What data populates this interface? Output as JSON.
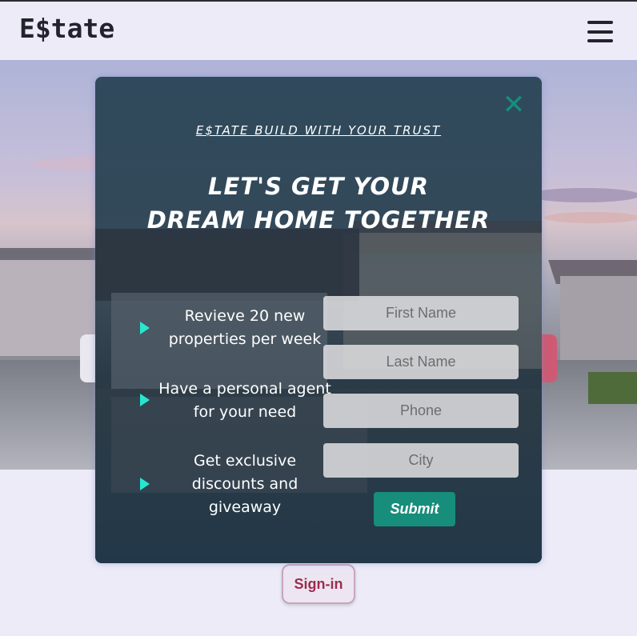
{
  "header": {
    "logo": "E$tate",
    "menu_icon": "hamburger-menu-icon"
  },
  "modal": {
    "close_icon": "close-icon",
    "close_glyph": "✕",
    "tagline": "E$tate build with your trust",
    "headline_line1": "LET'S GET YOUR",
    "headline_line2": "DREAM HOME TOGETHER",
    "features": [
      {
        "icon": "play-arrow-icon",
        "text": "Revieve 20 new properties per week"
      },
      {
        "icon": "play-arrow-icon",
        "text": "Have a personal agent for your need"
      },
      {
        "icon": "play-arrow-icon",
        "text": "Get exclusive discounts and giveaway"
      }
    ],
    "form": {
      "first_name_placeholder": "First Name",
      "last_name_placeholder": "Last Name",
      "phone_placeholder": "Phone",
      "city_placeholder": "City",
      "submit_label": "Submit"
    },
    "colors": {
      "accent": "#178d7b",
      "arrow": "#27e6cf"
    }
  },
  "page": {
    "signin_label": "Sign-in"
  }
}
